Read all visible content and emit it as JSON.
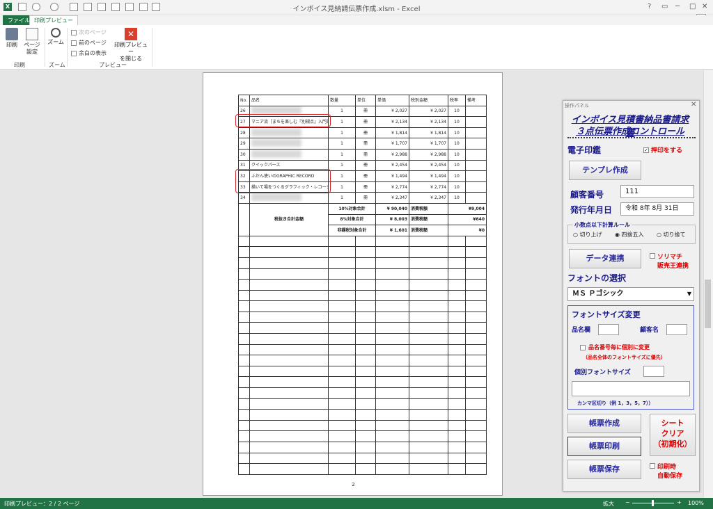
{
  "window": {
    "title": "インボイス見納請伝票作成.xlsm - Excel",
    "help": "?",
    "restore": "▭",
    "minimize": "─",
    "maximize": "□",
    "close": "✕"
  },
  "tabs": {
    "file": "ファイル",
    "preview": "印刷プレビュー"
  },
  "ribbon": {
    "print": "印刷",
    "page_setup_1": "ページ",
    "page_setup_2": "設定",
    "zoom": "ズーム",
    "next_page": "次のページ",
    "prev_page": "前のページ",
    "show_margins": "余白の表示",
    "close_preview_1": "印刷プレビュー",
    "close_preview_2": "を閉じる",
    "group_print": "印刷",
    "group_zoom": "ズーム",
    "group_preview": "プレビュー"
  },
  "sheet": {
    "headers": [
      "No.",
      "品名",
      "数量",
      "単位",
      "単価",
      "税別金額",
      "税率",
      "備考"
    ],
    "rows": [
      {
        "no": "26",
        "name": "",
        "qty": "1",
        "unit": "冊",
        "price": "¥ 2,027",
        "amount": "¥ 2,027",
        "rate": "10"
      },
      {
        "no": "27",
        "name": "マニア流［まちを楽しむ『別視点』入門］",
        "qty": "1",
        "unit": "冊",
        "price": "¥ 2,134",
        "amount": "¥ 2,134",
        "rate": "10"
      },
      {
        "no": "28",
        "name": "",
        "qty": "1",
        "unit": "冊",
        "price": "¥ 1,814",
        "amount": "¥ 1,814",
        "rate": "10"
      },
      {
        "no": "29",
        "name": "",
        "qty": "1",
        "unit": "冊",
        "price": "¥ 1,707",
        "amount": "¥ 1,707",
        "rate": "10"
      },
      {
        "no": "30",
        "name": "",
        "qty": "1",
        "unit": "冊",
        "price": "¥ 2,988",
        "amount": "¥ 2,988",
        "rate": "10"
      },
      {
        "no": "31",
        "name": "クイックパース",
        "qty": "1",
        "unit": "冊",
        "price": "¥ 2,454",
        "amount": "¥ 2,454",
        "rate": "10"
      },
      {
        "no": "32",
        "name": "ふだん使いのGRAPHIC RECORD",
        "qty": "1",
        "unit": "冊",
        "price": "¥ 1,494",
        "amount": "¥ 1,494",
        "rate": "10"
      },
      {
        "no": "33",
        "name": "描いて場をつくるグラフィック・レコーディ",
        "qty": "1",
        "unit": "冊",
        "price": "¥ 2,774",
        "amount": "¥ 2,774",
        "rate": "10"
      },
      {
        "no": "34",
        "name": "",
        "qty": "1",
        "unit": "冊",
        "price": "¥ 2,347",
        "amount": "¥ 2,347",
        "rate": "10"
      }
    ],
    "summary": {
      "label": "税抜き合計金額",
      "lines": [
        {
          "label": "10%対象合計",
          "value": "¥ 90,040",
          "tax_label": "消費税額",
          "tax": "¥9,004"
        },
        {
          "label": "8%対象合計",
          "value": "¥ 8,003",
          "tax_label": "消費税額",
          "tax": "¥640"
        },
        {
          "label": "非課税対象合計",
          "value": "¥ 1,601",
          "tax_label": "消費税額",
          "tax": "¥0"
        }
      ]
    },
    "page_number": "2"
  },
  "status": {
    "left": "印刷プレビュー：2 / 2 ページ",
    "zoom_label": "拡大",
    "zoom_value": "100%"
  },
  "panel": {
    "title": "操作パネル",
    "heading_1": "インボイス見積書納品書請求書",
    "heading_2": "３点伝票作成コントロール",
    "stamp_label": "電子印鑑",
    "stamp_check": "押印をする",
    "template_btn": "テンプレ作成",
    "customer_no_label": "顧客番号",
    "customer_no": "111",
    "issue_date_label": "発行年月日",
    "issue_date": "令和 8年 8月 31日",
    "rounding_title": "小数点以下計算ルール",
    "round_up": "切り上げ",
    "round_half": "四捨五入",
    "round_down": "切り捨て",
    "data_link_btn": "データ連携",
    "sorimachi_1": "ソリマチ",
    "sorimachi_2": "販売王連携",
    "font_select_label": "フォントの選択",
    "font_value": "ＭＳ Ｐゴシック",
    "font_size_title": "フォントサイズ変更",
    "item_col_label": "品名欄",
    "customer_name_label": "顧客名",
    "individual_check": "品名番号毎に個別に変更",
    "individual_note": "（品名全体のフォントサイズに優先）",
    "individual_size_label": "個別フォントサイズ",
    "comma_note": "カンマ区切り（例 1，3，5，7））",
    "create_btn": "帳票作成",
    "print_btn": "帳票印刷",
    "save_btn": "帳票保存",
    "clear_1": "シート",
    "clear_2": "クリア",
    "clear_3": "（初期化）",
    "auto_save_1": "印刷時",
    "auto_save_2": "自動保存"
  }
}
